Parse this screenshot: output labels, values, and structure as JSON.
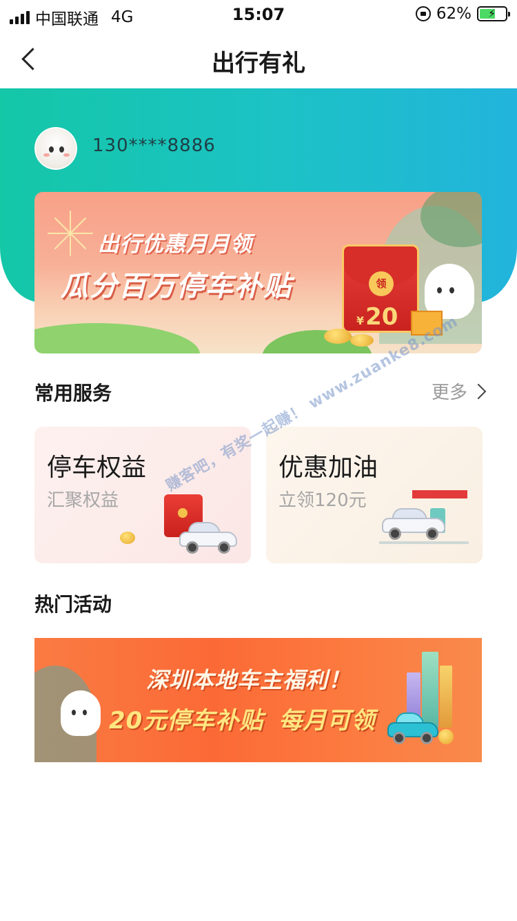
{
  "status_bar": {
    "carrier": "中国联通",
    "network": "4G",
    "time": "15:07",
    "battery_percent": "62%",
    "battery_level": 0.62
  },
  "nav": {
    "title": "出行有礼"
  },
  "user": {
    "phone": "130****8886"
  },
  "main_banner": {
    "line1": "出行优惠月月领",
    "line2": "瓜分百万停车补贴",
    "envelope_seal": "领",
    "envelope_currency": "¥",
    "envelope_amount": "20"
  },
  "services": {
    "title": "常用服务",
    "more_label": "更多",
    "items": [
      {
        "title": "停车权益",
        "subtitle": "汇聚权益"
      },
      {
        "title": "优惠加油",
        "subtitle": "立领120元"
      }
    ]
  },
  "activities": {
    "title": "热门活动",
    "banner_line1": "深圳本地车主福利！",
    "banner_line2a": "20元停车补贴",
    "banner_line2b": "每月可领"
  },
  "watermark": "赚客吧，有奖一起赚！ www.zuanke8.com",
  "colors": {
    "header_gradient_start": "#14c7a7",
    "header_gradient_end": "#22b4dc",
    "banner_orange": "#f8a088",
    "activity_orange": "#fb6a36",
    "envelope_red": "#c9221f"
  }
}
